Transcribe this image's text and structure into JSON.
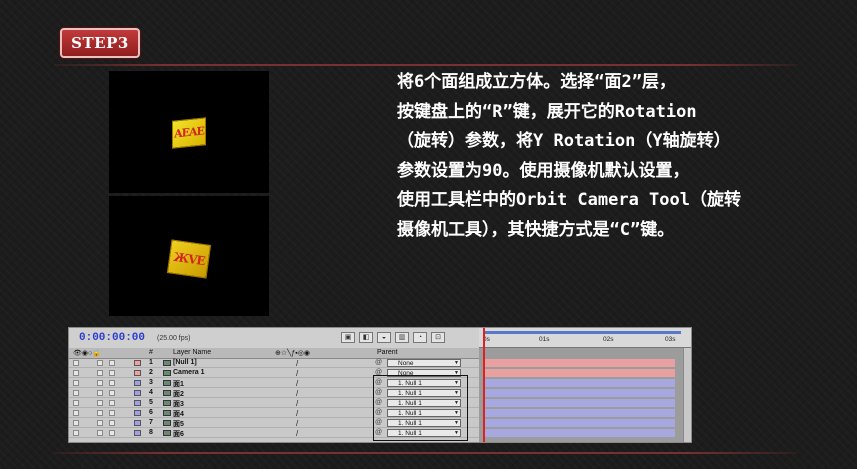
{
  "step": {
    "label": "STEP3"
  },
  "previews": [
    {
      "cube_text": "AEAE",
      "face_color": "#e6c800",
      "text_color": "#d1281e"
    },
    {
      "cube_text": "ЖVE",
      "face_color": "#e6c800",
      "text_color": "#d1281e"
    }
  ],
  "description": [
    "将6个面组成立方体。选择“面2”层，",
    "按键盘上的“R”键，展开它的Rotation",
    "（旋转）参数，将Y Rotation（Y轴旋转）",
    "参数设置为90。使用摄像机默认设置，",
    "使用工具栏中的Orbit Camera Tool（旋转",
    "摄像机工具），其快捷方式是“C”键。"
  ],
  "timeline": {
    "timecode": "0:00:00:00",
    "fps": "(25.00 fps)",
    "column_headers": {
      "num": "#",
      "layer_name": "Layer Name",
      "parent": "Parent"
    },
    "ruler": [
      "0s",
      "01s",
      "02s",
      "03s"
    ],
    "layers": [
      {
        "num": "1",
        "name": "[Null 1]",
        "parent": "None",
        "label_color": "#f0a0a0",
        "bar_color": "#e8a0a0"
      },
      {
        "num": "2",
        "name": "Camera 1",
        "parent": "None",
        "label_color": "#f0a0a0",
        "bar_color": "#e8a0a0"
      },
      {
        "num": "3",
        "name": "面1",
        "parent": "1. Null 1",
        "label_color": "#a0a0e8",
        "bar_color": "#a8a8e0"
      },
      {
        "num": "4",
        "name": "面2",
        "parent": "1. Null 1",
        "label_color": "#a0a0e8",
        "bar_color": "#a8a8e0"
      },
      {
        "num": "5",
        "name": "面3",
        "parent": "1. Null 1",
        "label_color": "#a0a0e8",
        "bar_color": "#a8a8e0"
      },
      {
        "num": "6",
        "name": "面4",
        "parent": "1. Null 1",
        "label_color": "#a0a0e8",
        "bar_color": "#a8a8e0"
      },
      {
        "num": "7",
        "name": "面5",
        "parent": "1. Null 1",
        "label_color": "#a0a0e8",
        "bar_color": "#a8a8e0"
      },
      {
        "num": "8",
        "name": "面6",
        "parent": "1. Null 1",
        "label_color": "#a0a0e8",
        "bar_color": "#a8a8e0"
      }
    ]
  }
}
